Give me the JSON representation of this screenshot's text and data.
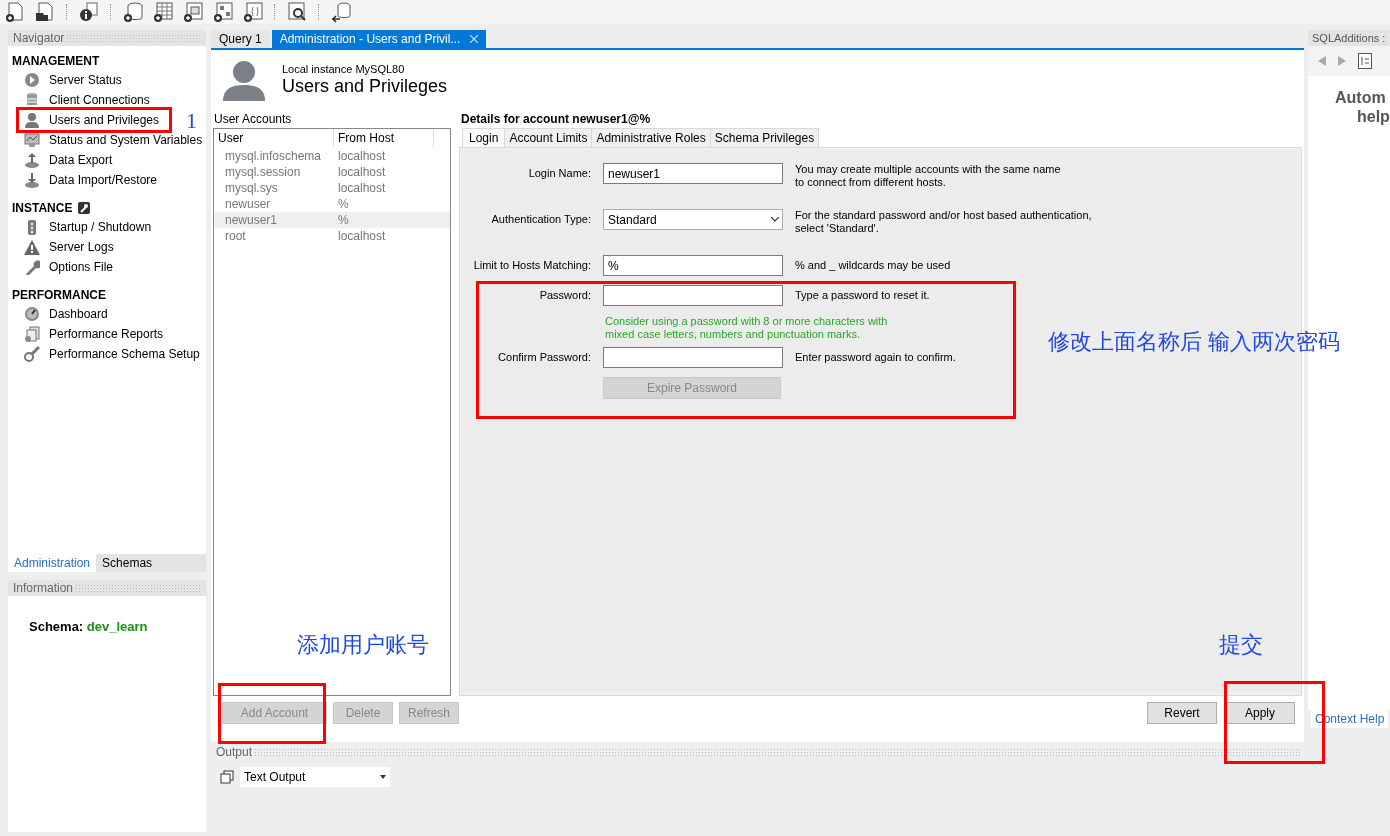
{
  "navigator": {
    "title": "Navigator",
    "sections": [
      {
        "title": "MANAGEMENT",
        "tool_icon": false,
        "items": [
          {
            "kind": "status",
            "label": "Server Status",
            "highlighted": false
          },
          {
            "kind": "connections",
            "label": "Client Connections",
            "highlighted": false
          },
          {
            "kind": "users",
            "label": "Users and Privileges",
            "highlighted": true,
            "note": "1"
          },
          {
            "kind": "variables",
            "label": "Status and System Variables",
            "highlighted": false
          },
          {
            "kind": "export",
            "label": "Data Export",
            "highlighted": false
          },
          {
            "kind": "import",
            "label": "Data Import/Restore",
            "highlighted": false
          }
        ]
      },
      {
        "title": "INSTANCE",
        "tool_icon": true,
        "items": [
          {
            "kind": "startup",
            "label": "Startup / Shutdown",
            "highlighted": false
          },
          {
            "kind": "logs",
            "label": "Server Logs",
            "highlighted": false
          },
          {
            "kind": "options",
            "label": "Options File",
            "highlighted": false
          }
        ]
      },
      {
        "title": "PERFORMANCE",
        "tool_icon": false,
        "items": [
          {
            "kind": "dashboard",
            "label": "Dashboard",
            "highlighted": false
          },
          {
            "kind": "reports",
            "label": "Performance Reports",
            "highlighted": false
          },
          {
            "kind": "setup",
            "label": "Performance Schema Setup",
            "highlighted": false
          }
        ]
      }
    ],
    "tabs": [
      {
        "label": "Administration",
        "selected": true
      },
      {
        "label": "Schemas",
        "selected": false
      }
    ]
  },
  "information": {
    "title": "Information",
    "schema_label": "Schema:",
    "schema_value": "dev_learn"
  },
  "editor_tabs": [
    {
      "label": "Query 1",
      "selected": false,
      "closable": false
    },
    {
      "label": "Administration - Users and Privil...",
      "selected": true,
      "closable": true
    }
  ],
  "header": {
    "subtitle": "Local instance MySQL80",
    "title": "Users and Privileges"
  },
  "accounts": {
    "title": "User Accounts",
    "columns": [
      "User",
      "From Host"
    ],
    "rows": [
      {
        "user": "mysql.infoschema",
        "host": "localhost",
        "selected": false
      },
      {
        "user": "mysql.session",
        "host": "localhost",
        "selected": false
      },
      {
        "user": "mysql.sys",
        "host": "localhost",
        "selected": false
      },
      {
        "user": "newuser",
        "host": "%",
        "selected": false
      },
      {
        "user": "newuser1",
        "host": "%",
        "selected": true
      },
      {
        "user": "root",
        "host": "localhost",
        "selected": false
      }
    ],
    "buttons": [
      {
        "label": "Add Account",
        "disabled": true,
        "highlighted": true,
        "note": "添加用户账号"
      },
      {
        "label": "Delete",
        "disabled": true,
        "highlighted": false
      },
      {
        "label": "Refresh",
        "disabled": true,
        "highlighted": false
      }
    ]
  },
  "details": {
    "title": "Details for account newuser1@%",
    "tabs": [
      {
        "label": "Login",
        "selected": true
      },
      {
        "label": "Account Limits",
        "selected": false
      },
      {
        "label": "Administrative Roles",
        "selected": false
      },
      {
        "label": "Schema Privileges",
        "selected": false
      }
    ],
    "fields": [
      {
        "kind": "text",
        "label": "Login Name:",
        "value": "newuser1",
        "help": "You may create multiple accounts with the same name\nto connect from different hosts."
      },
      {
        "kind": "select",
        "label": "Authentication Type:",
        "value": "Standard",
        "help": "For the standard password and/or host based authentication,\nselect 'Standard'."
      },
      {
        "kind": "text",
        "label": "Limit to Hosts Matching:",
        "value": "%",
        "help": "% and _ wildcards may be used"
      }
    ],
    "password_group": {
      "highlighted": true,
      "note": "修改上面名称后  输入两次密码",
      "fields": [
        {
          "kind": "password",
          "label": "Password:",
          "help": "Type a password to reset it."
        },
        {
          "kind": "hint",
          "text": "Consider using a password with 8 or more characters with\nmixed case letters, numbers and punctuation marks."
        },
        {
          "kind": "password",
          "label": "Confirm Password:",
          "help": "Enter password again to confirm."
        },
        {
          "kind": "button",
          "label": "Expire Password",
          "disabled": true
        }
      ]
    }
  },
  "footer_buttons": [
    {
      "label": "Revert",
      "disabled": false,
      "highlighted": false
    },
    {
      "label": "Apply",
      "disabled": false,
      "highlighted": true,
      "note": "提交"
    }
  ],
  "output": {
    "title": "Output",
    "mode": "Text Output"
  },
  "side_panel": {
    "title": "SQLAdditions :",
    "lines": [
      "Autom",
      "help"
    ],
    "tab": "Context Help"
  }
}
